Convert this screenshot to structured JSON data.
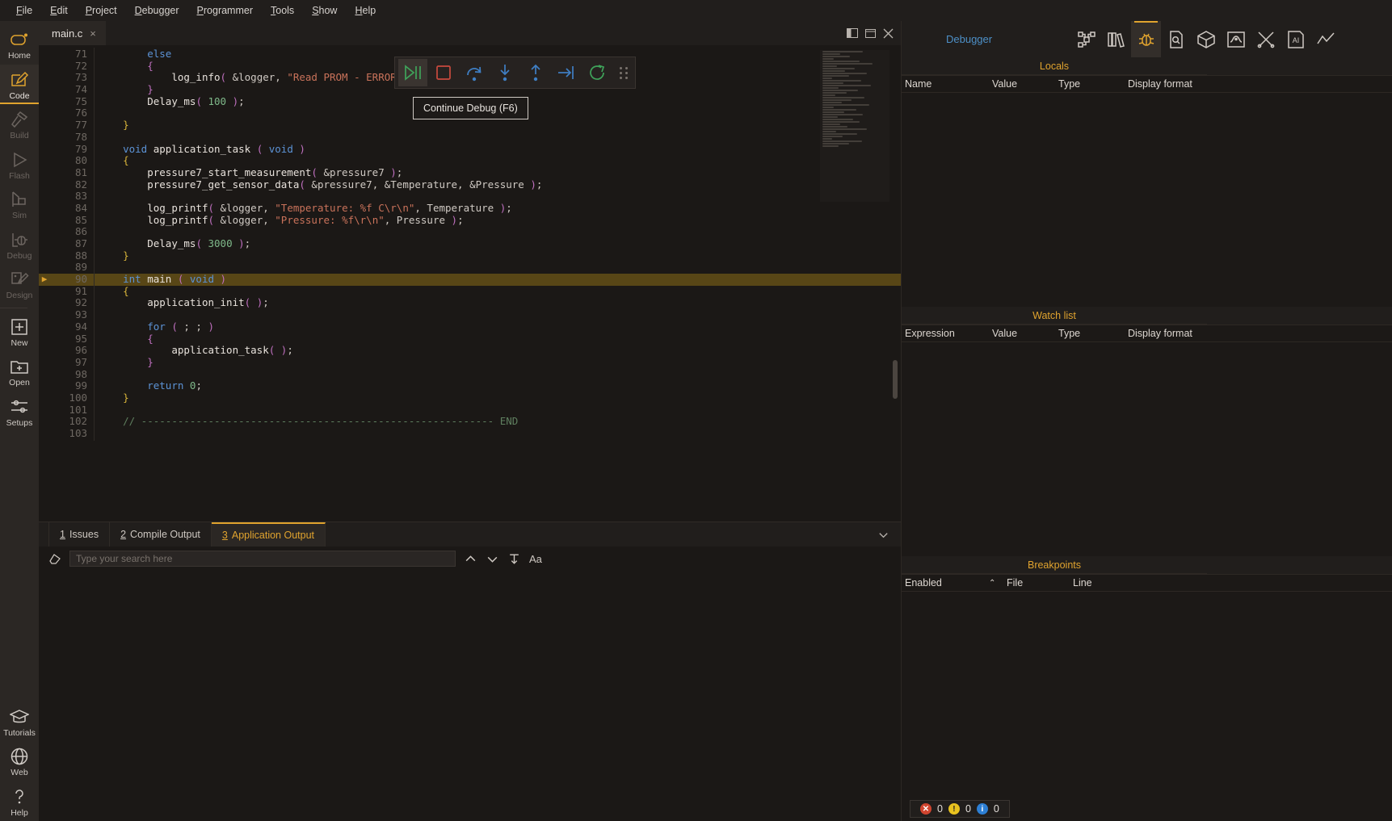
{
  "menubar": {
    "items": [
      {
        "label": "File",
        "mnemonic": "F"
      },
      {
        "label": "Edit",
        "mnemonic": "E"
      },
      {
        "label": "Project",
        "mnemonic": "P"
      },
      {
        "label": "Debugger",
        "mnemonic": "D"
      },
      {
        "label": "Programmer",
        "mnemonic": "P"
      },
      {
        "label": "Tools",
        "mnemonic": "T"
      },
      {
        "label": "Show",
        "mnemonic": "S"
      },
      {
        "label": "Help",
        "mnemonic": "H"
      }
    ]
  },
  "sidebar": {
    "items": [
      {
        "label": "Home",
        "icon": "home-capsule-icon",
        "state": "normal"
      },
      {
        "label": "Code",
        "icon": "pencil-edit-icon",
        "state": "active"
      },
      {
        "label": "Build",
        "icon": "hammer-icon",
        "state": "disabled"
      },
      {
        "label": "Flash",
        "icon": "play-triangle-icon",
        "state": "disabled"
      },
      {
        "label": "Sim",
        "icon": "simulator-icon",
        "state": "disabled"
      },
      {
        "label": "Debug",
        "icon": "debug-bug-icon",
        "state": "disabled"
      },
      {
        "label": "Design",
        "icon": "design-pencil-icon",
        "state": "disabled"
      },
      {
        "label": "New",
        "icon": "plus-square-icon",
        "state": "normal"
      },
      {
        "label": "Open",
        "icon": "folder-plus-icon",
        "state": "normal"
      },
      {
        "label": "Setups",
        "icon": "sliders-icon",
        "state": "normal"
      }
    ],
    "bottom_items": [
      {
        "label": "Tutorials",
        "icon": "graduation-cap-icon"
      },
      {
        "label": "Web",
        "icon": "globe-icon"
      },
      {
        "label": "Help",
        "icon": "question-mark-icon"
      }
    ]
  },
  "editor": {
    "tab": {
      "name": "main.c",
      "close": "×"
    },
    "window_buttons": [
      "split-view-icon",
      "restore-icon",
      "close-icon"
    ],
    "first_line": 71,
    "highlighted_line": 90,
    "lines": [
      {
        "n": 71,
        "tokens": [
          {
            "t": "        ",
            "c": "wh"
          },
          {
            "t": "else",
            "c": "k"
          }
        ]
      },
      {
        "n": 72,
        "tokens": [
          {
            "t": "        ",
            "c": "wh"
          },
          {
            "t": "{",
            "c": "pn"
          }
        ]
      },
      {
        "n": 73,
        "tokens": [
          {
            "t": "            ",
            "c": "wh"
          },
          {
            "t": "log_info",
            "c": "fn"
          },
          {
            "t": "(",
            "c": "pn"
          },
          {
            "t": " &logger, ",
            "c": "wh"
          },
          {
            "t": "\"Read PROM - ERROR!\\r\\n\"",
            "c": "st"
          },
          {
            "t": " )",
            "c": "pn"
          },
          {
            "t": ";",
            "c": "wh"
          }
        ]
      },
      {
        "n": 74,
        "tokens": [
          {
            "t": "        ",
            "c": "wh"
          },
          {
            "t": "}",
            "c": "pn"
          }
        ]
      },
      {
        "n": 75,
        "tokens": [
          {
            "t": "        ",
            "c": "wh"
          },
          {
            "t": "Delay_ms",
            "c": "fn"
          },
          {
            "t": "(",
            "c": "pn"
          },
          {
            "t": " ",
            "c": "wh"
          },
          {
            "t": "100",
            "c": "nm"
          },
          {
            "t": " )",
            "c": "pn"
          },
          {
            "t": ";",
            "c": "wh"
          }
        ]
      },
      {
        "n": 76,
        "tokens": []
      },
      {
        "n": 77,
        "tokens": [
          {
            "t": "    ",
            "c": "wh"
          },
          {
            "t": "}",
            "c": "br"
          }
        ]
      },
      {
        "n": 78,
        "tokens": []
      },
      {
        "n": 79,
        "tokens": [
          {
            "t": "    ",
            "c": "wh"
          },
          {
            "t": "void",
            "c": "k"
          },
          {
            "t": " application_task ",
            "c": "fn"
          },
          {
            "t": "(",
            "c": "pn"
          },
          {
            "t": " ",
            "c": "wh"
          },
          {
            "t": "void",
            "c": "k"
          },
          {
            "t": " )",
            "c": "pn"
          }
        ]
      },
      {
        "n": 80,
        "tokens": [
          {
            "t": "    ",
            "c": "wh"
          },
          {
            "t": "{",
            "c": "br"
          }
        ]
      },
      {
        "n": 81,
        "tokens": [
          {
            "t": "        ",
            "c": "wh"
          },
          {
            "t": "pressure7_start_measurement",
            "c": "fn"
          },
          {
            "t": "(",
            "c": "pn"
          },
          {
            "t": " &pressure7 ",
            "c": "wh"
          },
          {
            "t": ")",
            "c": "pn"
          },
          {
            "t": ";",
            "c": "wh"
          }
        ]
      },
      {
        "n": 82,
        "tokens": [
          {
            "t": "        ",
            "c": "wh"
          },
          {
            "t": "pressure7_get_sensor_data",
            "c": "fn"
          },
          {
            "t": "(",
            "c": "pn"
          },
          {
            "t": " &pressure7, &Temperature, &Pressure ",
            "c": "wh"
          },
          {
            "t": ")",
            "c": "pn"
          },
          {
            "t": ";",
            "c": "wh"
          }
        ]
      },
      {
        "n": 83,
        "tokens": []
      },
      {
        "n": 84,
        "tokens": [
          {
            "t": "        ",
            "c": "wh"
          },
          {
            "t": "log_printf",
            "c": "fn"
          },
          {
            "t": "(",
            "c": "pn"
          },
          {
            "t": " &logger, ",
            "c": "wh"
          },
          {
            "t": "\"Temperature: %f C\\r\\n\"",
            "c": "st"
          },
          {
            "t": ", Temperature ",
            "c": "wh"
          },
          {
            "t": ")",
            "c": "pn"
          },
          {
            "t": ";",
            "c": "wh"
          }
        ]
      },
      {
        "n": 85,
        "tokens": [
          {
            "t": "        ",
            "c": "wh"
          },
          {
            "t": "log_printf",
            "c": "fn"
          },
          {
            "t": "(",
            "c": "pn"
          },
          {
            "t": " &logger, ",
            "c": "wh"
          },
          {
            "t": "\"Pressure: %f\\r\\n\"",
            "c": "st"
          },
          {
            "t": ", Pressure ",
            "c": "wh"
          },
          {
            "t": ")",
            "c": "pn"
          },
          {
            "t": ";",
            "c": "wh"
          }
        ]
      },
      {
        "n": 86,
        "tokens": []
      },
      {
        "n": 87,
        "tokens": [
          {
            "t": "        ",
            "c": "wh"
          },
          {
            "t": "Delay_ms",
            "c": "fn"
          },
          {
            "t": "(",
            "c": "pn"
          },
          {
            "t": " ",
            "c": "wh"
          },
          {
            "t": "3000",
            "c": "nm"
          },
          {
            "t": " )",
            "c": "pn"
          },
          {
            "t": ";",
            "c": "wh"
          }
        ]
      },
      {
        "n": 88,
        "tokens": [
          {
            "t": "    ",
            "c": "wh"
          },
          {
            "t": "}",
            "c": "br"
          }
        ]
      },
      {
        "n": 89,
        "tokens": []
      },
      {
        "n": 90,
        "tokens": [
          {
            "t": "    ",
            "c": "wh"
          },
          {
            "t": "int",
            "c": "k"
          },
          {
            "t": " main ",
            "c": "fn"
          },
          {
            "t": "(",
            "c": "pn"
          },
          {
            "t": " ",
            "c": "wh"
          },
          {
            "t": "void",
            "c": "k"
          },
          {
            "t": " )",
            "c": "pn"
          }
        ]
      },
      {
        "n": 91,
        "tokens": [
          {
            "t": "    ",
            "c": "wh"
          },
          {
            "t": "{",
            "c": "br"
          }
        ]
      },
      {
        "n": 92,
        "tokens": [
          {
            "t": "        ",
            "c": "wh"
          },
          {
            "t": "application_init",
            "c": "fn"
          },
          {
            "t": "(",
            "c": "pn"
          },
          {
            "t": " )",
            "c": "pn"
          },
          {
            "t": ";",
            "c": "wh"
          }
        ]
      },
      {
        "n": 93,
        "tokens": []
      },
      {
        "n": 94,
        "tokens": [
          {
            "t": "        ",
            "c": "wh"
          },
          {
            "t": "for",
            "c": "k"
          },
          {
            "t": " ",
            "c": "wh"
          },
          {
            "t": "(",
            "c": "pn"
          },
          {
            "t": " ; ; ",
            "c": "wh"
          },
          {
            "t": ")",
            "c": "pn"
          }
        ]
      },
      {
        "n": 95,
        "tokens": [
          {
            "t": "        ",
            "c": "wh"
          },
          {
            "t": "{",
            "c": "pn"
          }
        ]
      },
      {
        "n": 96,
        "tokens": [
          {
            "t": "            ",
            "c": "wh"
          },
          {
            "t": "application_task",
            "c": "fn"
          },
          {
            "t": "(",
            "c": "pn"
          },
          {
            "t": " )",
            "c": "pn"
          },
          {
            "t": ";",
            "c": "wh"
          }
        ]
      },
      {
        "n": 97,
        "tokens": [
          {
            "t": "        ",
            "c": "wh"
          },
          {
            "t": "}",
            "c": "pn"
          }
        ]
      },
      {
        "n": 98,
        "tokens": []
      },
      {
        "n": 99,
        "tokens": [
          {
            "t": "        ",
            "c": "wh"
          },
          {
            "t": "return",
            "c": "k"
          },
          {
            "t": " ",
            "c": "wh"
          },
          {
            "t": "0",
            "c": "nm"
          },
          {
            "t": ";",
            "c": "wh"
          }
        ]
      },
      {
        "n": 100,
        "tokens": [
          {
            "t": "    ",
            "c": "wh"
          },
          {
            "t": "}",
            "c": "br"
          }
        ]
      },
      {
        "n": 101,
        "tokens": []
      },
      {
        "n": 102,
        "tokens": [
          {
            "t": "    ",
            "c": "wh"
          },
          {
            "t": "// ---------------------------------------------------------- END",
            "c": "cm"
          }
        ]
      },
      {
        "n": 103,
        "tokens": []
      }
    ]
  },
  "debug_toolbar": {
    "buttons": [
      {
        "name": "continue-debug-button",
        "icon": "play-pause-icon",
        "color": "#3fa35a",
        "active": true
      },
      {
        "name": "stop-debug-button",
        "icon": "stop-square-icon",
        "color": "#c94a3e",
        "active": false
      },
      {
        "name": "step-over-button",
        "icon": "step-over-icon",
        "color": "#3f7fc4",
        "active": false
      },
      {
        "name": "step-into-button",
        "icon": "step-into-icon",
        "color": "#3f7fc4",
        "active": false
      },
      {
        "name": "step-out-button",
        "icon": "step-out-icon",
        "color": "#3f7fc4",
        "active": false
      },
      {
        "name": "run-to-cursor-button",
        "icon": "run-to-line-icon",
        "color": "#3f7fc4",
        "active": false
      },
      {
        "name": "restart-debug-button",
        "icon": "restart-icon",
        "color": "#3fa35a",
        "active": false
      }
    ],
    "tooltip": "Continue Debug (F6)"
  },
  "output_panel": {
    "tabs": [
      {
        "num": "1",
        "label": "Issues",
        "active": false
      },
      {
        "num": "2",
        "label": "Compile Output",
        "active": false
      },
      {
        "num": "3",
        "label": "Application Output",
        "active": true
      }
    ],
    "collapse_icon": "chevron-down-icon",
    "search": {
      "clear_icon": "eraser-icon",
      "placeholder": "Type your search here",
      "value": "",
      "prev_icon": "chevron-up-icon",
      "next_icon": "chevron-down-icon",
      "wrap_icon": "text-wrap-icon",
      "case_icon": "Aa"
    }
  },
  "right_panel": {
    "title": "Debugger",
    "icons": [
      {
        "name": "project-tree-icon",
        "active": false
      },
      {
        "name": "library-manager-icon",
        "active": false
      },
      {
        "name": "debug-bug-icon",
        "active": true
      },
      {
        "name": "file-search-icon",
        "active": false
      },
      {
        "name": "cube-3d-icon",
        "active": false
      },
      {
        "name": "oscilloscope-icon",
        "active": false
      },
      {
        "name": "tools-icon",
        "active": false
      },
      {
        "name": "ai-assistant-icon",
        "active": false
      },
      {
        "name": "chart-line-icon",
        "active": false
      }
    ],
    "panes": [
      {
        "title": "Locals",
        "columns": [
          "Name",
          "Value",
          "Type",
          "Display format"
        ],
        "rows": []
      },
      {
        "title": "Watch list",
        "columns": [
          "Expression",
          "Value",
          "Type",
          "Display format"
        ],
        "rows": []
      },
      {
        "title": "Breakpoints",
        "columns": [
          "Enabled",
          "File",
          "Line"
        ],
        "rows": [],
        "sort_icon": "caret-up-icon"
      }
    ]
  },
  "statusbar": {
    "errors": "0",
    "warnings": "0",
    "infos": "0",
    "error_color": "#d0452f",
    "warning_color": "#e8c21f",
    "info_color": "#2d7fd4"
  }
}
